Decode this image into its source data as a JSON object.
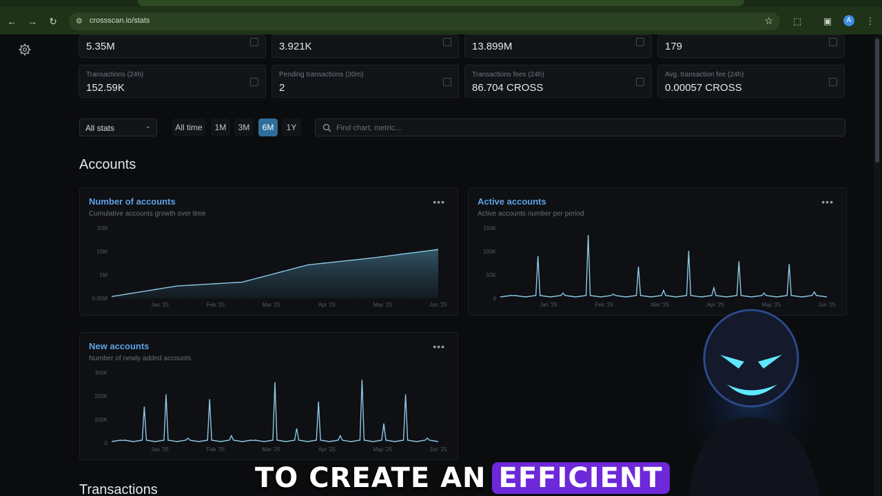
{
  "browser": {
    "url": "crossscan.io/stats",
    "profile_initial": "A"
  },
  "stats": [
    {
      "label": "",
      "value": "5.35M"
    },
    {
      "label": "",
      "value": "3.921K"
    },
    {
      "label": "",
      "value": "13.899M"
    },
    {
      "label": "",
      "value": "179"
    },
    {
      "label": "Transactions (24h)",
      "value": "152.59K"
    },
    {
      "label": "Pending transactions (30m)",
      "value": "2"
    },
    {
      "label": "Transactions fees (24h)",
      "value": "86.704 CROSS"
    },
    {
      "label": "Avg. transaction fee (24h)",
      "value": "0.00057 CROSS"
    }
  ],
  "filters": {
    "select_value": "All stats",
    "ranges": [
      "All time",
      "1M",
      "3M",
      "6M",
      "1Y"
    ],
    "active_range": "6M",
    "search_placeholder": "Find chart, metric..."
  },
  "sections": {
    "accounts": "Accounts",
    "transactions": "Transactions"
  },
  "charts": {
    "number_of_accounts": {
      "title": "Number of accounts",
      "subtitle": "Cumulative accounts growth over time",
      "menu": "•••",
      "y_ticks": [
        "20M",
        "15M",
        "5M",
        "0.00M"
      ],
      "x_ticks": [
        "Jan '25",
        "Feb '25",
        "Mar '25",
        "Apr '25",
        "May '25",
        "Jun '25"
      ]
    },
    "active_accounts": {
      "title": "Active accounts",
      "subtitle": "Active accounts number per period",
      "menu": "•••",
      "y_ticks": [
        "150K",
        "100K",
        "50K",
        "0"
      ],
      "x_ticks": [
        "Jan '25",
        "Feb '25",
        "Mar '25",
        "Apr '25",
        "May '25",
        "Jun '25"
      ]
    },
    "new_accounts": {
      "title": "New accounts",
      "subtitle": "Number of newly added accounts",
      "menu": "•••",
      "y_ticks": [
        "300K",
        "200K",
        "100K",
        "0"
      ],
      "x_ticks": [
        "Jan '25",
        "Feb '25",
        "Mar '25",
        "Apr '25",
        "May '25",
        "Jun '25"
      ]
    }
  },
  "caption": {
    "plain": "TO CREATE AN",
    "highlight": "EFFICIENT"
  },
  "colors": {
    "accent": "#5fa2e6",
    "active_range": "#2f6d9a",
    "caption_highlight": "#6d28d9",
    "chart_line": "#8ec9e6"
  },
  "chart_data": [
    {
      "type": "area",
      "title": "Number of accounts",
      "x": [
        "Jan '25",
        "Feb '25",
        "Mar '25",
        "Apr '25",
        "May '25",
        "Jun '25"
      ],
      "series": [
        {
          "values": [
            0.5,
            3.5,
            4.6,
            9.5,
            11.5,
            13.9
          ]
        }
      ],
      "ylim": [
        0,
        20
      ],
      "grid": false
    },
    {
      "type": "line",
      "title": "Active accounts",
      "x": [
        "Jan '25",
        "Feb '25",
        "Mar '25",
        "Apr '25",
        "May '25",
        "Jun '25"
      ],
      "series": [
        {
          "values": [
            5,
            80,
            10,
            120,
            8,
            60,
            15,
            90,
            20,
            70,
            10,
            65,
            12
          ]
        }
      ],
      "ylim": [
        0,
        150000
      ],
      "grid": false
    },
    {
      "type": "line",
      "title": "New accounts",
      "x": [
        "Jan '25",
        "Feb '25",
        "Mar '25",
        "Apr '25",
        "May '25",
        "Jun '25"
      ],
      "series": [
        {
          "values": [
            10,
            150,
            200,
            20,
            180,
            30,
            10,
            250,
            60,
            170,
            30,
            260,
            80,
            200,
            20
          ]
        }
      ],
      "ylim": [
        0,
        300000
      ],
      "grid": false
    }
  ]
}
